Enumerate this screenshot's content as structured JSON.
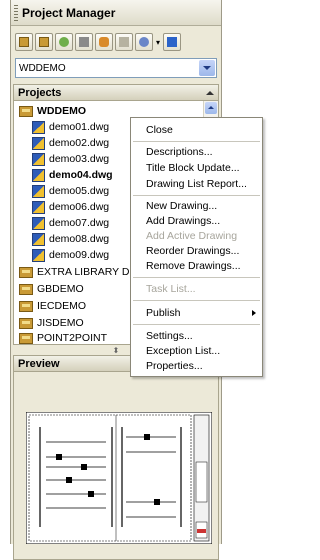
{
  "panel": {
    "title": "Project Manager"
  },
  "toolbar": {
    "buttons": [
      "new-project-icon",
      "open-project-icon",
      "refresh-icon",
      "wand-icon",
      "search-icon",
      "settings-icon",
      "dropdown-icon",
      "help-icon"
    ]
  },
  "project_combo": {
    "value": "WDDEMO"
  },
  "projects": {
    "header": "Projects",
    "active_project": "WDDEMO",
    "drawings": [
      "demo01.dwg",
      "demo02.dwg",
      "demo03.dwg",
      "demo04.dwg",
      "demo05.dwg",
      "demo06.dwg",
      "demo07.dwg",
      "demo08.dwg",
      "demo09.dwg"
    ],
    "other_projects": [
      "EXTRA LIBRARY DEM",
      "GBDEMO",
      "IECDEMO",
      "JISDEMO",
      "POINT2POINT"
    ]
  },
  "preview": {
    "header": "Preview"
  },
  "context_menu": {
    "close": "Close",
    "descriptions": "Descriptions...",
    "title_block_update": "Title Block Update...",
    "drawing_list_report": "Drawing List Report...",
    "new_drawing": "New Drawing...",
    "add_drawings": "Add Drawings...",
    "add_active_drawing": "Add Active Drawing",
    "reorder_drawings": "Reorder Drawings...",
    "remove_drawings": "Remove Drawings...",
    "task_list": "Task List...",
    "publish": "Publish",
    "settings": "Settings...",
    "exception_list": "Exception List...",
    "properties": "Properties..."
  },
  "colors": {
    "panel_bg": "#ece9d8",
    "accent_blue": "#9db8ea",
    "disabled_text": "#a7a59c"
  }
}
